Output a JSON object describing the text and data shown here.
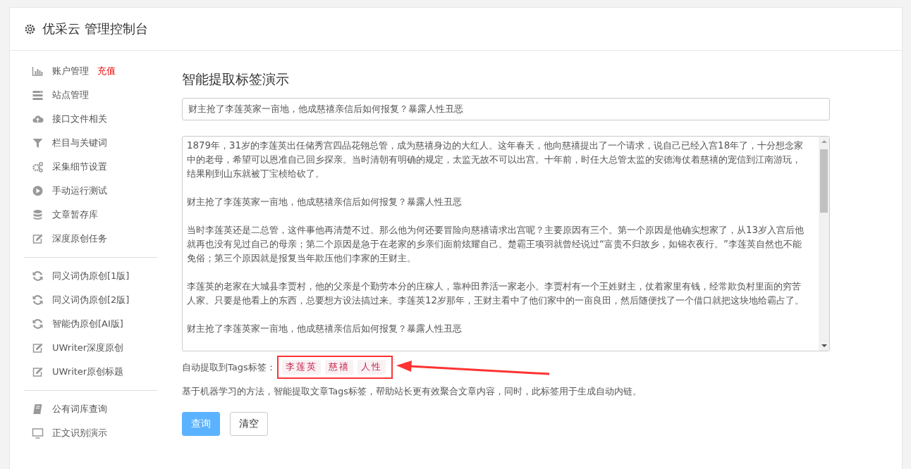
{
  "header": {
    "title": "优采云 管理控制台"
  },
  "sidebar": {
    "groups": [
      [
        {
          "label": "账户管理",
          "badge": "充值"
        },
        {
          "label": "站点管理"
        },
        {
          "label": "接口文件相关"
        },
        {
          "label": "栏目与关键词"
        },
        {
          "label": "采集细节设置"
        },
        {
          "label": "手动运行测试"
        },
        {
          "label": "文章暂存库"
        },
        {
          "label": "深度原创任务"
        }
      ],
      [
        {
          "label": "同义词伪原创[1版]"
        },
        {
          "label": "同义词伪原创[2版]"
        },
        {
          "label": "智能伪原创[AI版]"
        },
        {
          "label": "UWriter深度原创"
        },
        {
          "label": "UWriter原创标题"
        }
      ],
      [
        {
          "label": "公有词库查询"
        },
        {
          "label": "正文识别演示"
        }
      ]
    ]
  },
  "main": {
    "title": "智能提取标签演示",
    "title_field": {
      "value": "财主抢了李莲英家一亩地，他成慈禧亲信后如何报复？暴露人性丑恶"
    },
    "content_field": {
      "paragraphs": [
        "1879年，31岁的李莲英出任储秀宫四品花翎总管，成为慈禧身边的大红人。这年春天，他向慈禧提出了一个请求，说自己已经入宫18年了，十分想念家中的老母，希望可以恩准自己回乡探亲。当时清朝有明确的规定，太监无故不可以出宫。十年前，时任大总管太监的安德海仗着慈禧的宠信到江南游玩，结果刚到山东就被丁宝桢给砍了。",
        "财主抢了李莲英家一亩地，他成慈禧亲信后如何报复？暴露人性丑恶",
        "当时李莲英还是二总管，这件事他再清楚不过。那么他为何还要冒险向慈禧请求出宫呢？主要原因有三个。第一个原因是他确实想家了，从13岁入宫后他就再也没有见过自己的母亲；第二个原因是急于在老家的乡亲们面前炫耀自己。楚霸王项羽就曾经说过“富贵不归故乡，如锦衣夜行。”李莲英自然也不能免俗；第三个原因就是报复当年欺压他们李家的王财主。",
        "李莲英的老家在大城县李贾村，他的父亲是个勤劳本分的庄稼人，靠种田养活一家老小。李贾村有一个王姓财主，仗着家里有钱，经常欺负村里面的穷苦人家。只要是他看上的东西，总要想方设法搞过来。李莲英12岁那年，王财主看中了他们家中的一亩良田，然后随便找了一个借口就把这块地给霸占了。",
        "财主抢了李莲英家一亩地，他成慈禧亲信后如何报复？暴露人性丑恶"
      ]
    },
    "tags_label": "自动提取到Tags标签：",
    "tags": [
      "李莲英",
      "慈禧",
      "人性"
    ],
    "description": "基于机器学习的方法，智能提取文章Tags标签，帮助站长更有效聚合文章内容，同时，此标签用于生成自动内链。",
    "buttons": [
      {
        "label": "查询",
        "kind": "primary"
      },
      {
        "label": "清空",
        "kind": "default"
      }
    ]
  }
}
